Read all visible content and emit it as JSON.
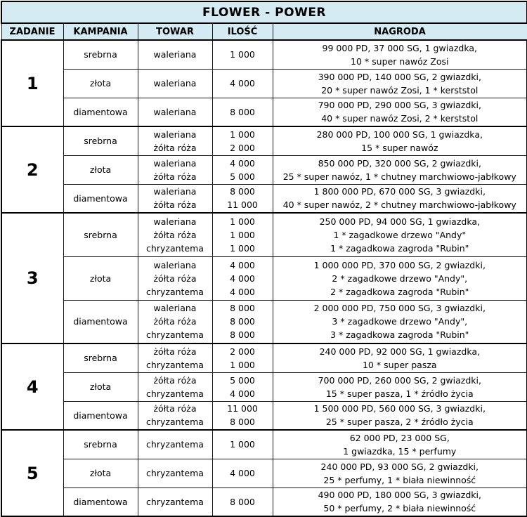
{
  "title": "FLOWER - POWER",
  "headers": [
    "ZADANIE",
    "KAMPANIA",
    "TOWAR",
    "ILOŚĆ",
    "NAGRODA"
  ],
  "tasks": [
    {
      "number": "1",
      "campaigns": [
        {
          "name": "srebrna",
          "items": [
            "waleriana"
          ],
          "qty": [
            "1 000"
          ],
          "reward": [
            "99 000 PD, 37 000 SG, 1 gwiazdka,",
            "10 * super nawóz Zosi"
          ]
        },
        {
          "name": "złota",
          "items": [
            "waleriana"
          ],
          "qty": [
            "4 000"
          ],
          "reward": [
            "390 000 PD, 140 000 SG, 2 gwiazdki,",
            "20 * super nawóz Zosi, 1 * kerststol"
          ]
        },
        {
          "name": "diamentowa",
          "items": [
            "waleriana"
          ],
          "qty": [
            "8 000"
          ],
          "reward": [
            "790 000 PD, 290 000 SG, 3 gwiazdki,",
            "40 * super nawóz Zosi, 2 * kerststol"
          ]
        }
      ]
    },
    {
      "number": "2",
      "campaigns": [
        {
          "name": "srebrna",
          "items": [
            "waleriana",
            "żółta róża"
          ],
          "qty": [
            "1 000",
            "2 000"
          ],
          "reward": [
            "280 000 PD, 100 000 SG, 1 gwiazdka,",
            "15 * super nawóz"
          ]
        },
        {
          "name": "złota",
          "items": [
            "waleriana",
            "żółta róża"
          ],
          "qty": [
            "4 000",
            "5 000"
          ],
          "reward": [
            "850 000 PD, 320 000 SG, 2 gwiazdki,",
            "25 * super nawóz, 1 * chutney marchwiowo-jabłkowy"
          ]
        },
        {
          "name": "diamentowa",
          "items": [
            "waleriana",
            "żółta róża"
          ],
          "qty": [
            "8 000",
            "11 000"
          ],
          "reward": [
            "1 800 000 PD, 670 000 SG, 3 gwiazdki,",
            "40 * super nawóz, 2 * chutney marchwiowo-jabłkowy"
          ]
        }
      ]
    },
    {
      "number": "3",
      "campaigns": [
        {
          "name": "srebrna",
          "items": [
            "waleriana",
            "żółta róża",
            "chryzantema"
          ],
          "qty": [
            "1 000",
            "1 000",
            "1 000"
          ],
          "reward": [
            "250 000 PD, 94 000 SG, 1 gwiazdka,",
            "1 * zagadkowe drzewo \"Andy\"",
            "1 * zagadkowa zagroda \"Rubin\""
          ]
        },
        {
          "name": "złota",
          "items": [
            "waleriana",
            "żółta róża",
            "chryzantema"
          ],
          "qty": [
            "4 000",
            "4 000",
            "4 000"
          ],
          "reward": [
            "1 000 000 PD, 370 000 SG, 2 gwiazdki,",
            "2 * zagadkowe drzewo \"Andy\",",
            "2 * zagadkowa zagroda \"Rubin\""
          ]
        },
        {
          "name": "diamentowa",
          "items": [
            "waleriana",
            "żółta róża",
            "chryzantema"
          ],
          "qty": [
            "8 000",
            "8 000",
            "8 000"
          ],
          "reward": [
            "2 000 000 PD, 750 000 SG, 3 gwiazdki,",
            "3 * zagadkowe drzewo \"Andy\",",
            "3 * zagadkowa zagroda \"Rubin\""
          ]
        }
      ]
    },
    {
      "number": "4",
      "campaigns": [
        {
          "name": "srebrna",
          "items": [
            "żółta róża",
            "chryzantema"
          ],
          "qty": [
            "2 000",
            "1 000"
          ],
          "reward": [
            "240 000 PD, 92 000 SG, 1 gwiazdka,",
            "10 * super pasza"
          ]
        },
        {
          "name": "złota",
          "items": [
            "żółta róża",
            "chryzantema"
          ],
          "qty": [
            "5 000",
            "4 000"
          ],
          "reward": [
            "700 000 PD, 260 000 SG, 2 gwiazdki,",
            "15 * super pasza, 1 * źródło życia"
          ]
        },
        {
          "name": "diamentowa",
          "items": [
            "żółta róża",
            "chryzantema"
          ],
          "qty": [
            "11 000",
            "8 000"
          ],
          "reward": [
            "1 500 000 PD, 560 000 SG, 3 gwiazdki,",
            "25 * super pasza, 2 * źródło życia"
          ]
        }
      ]
    },
    {
      "number": "5",
      "campaigns": [
        {
          "name": "srebrna",
          "items": [
            "chryzantema"
          ],
          "qty": [
            "1 000"
          ],
          "reward": [
            "62 000 PD, 23 000 SG,",
            "1 gwiazdka, 15 * perfumy"
          ]
        },
        {
          "name": "złota",
          "items": [
            "chryzantema"
          ],
          "qty": [
            "4 000"
          ],
          "reward": [
            "240 000 PD, 93 000 SG, 2 gwiazdki,",
            "25 * perfumy, 1 * biała niewinność"
          ]
        },
        {
          "name": "diamentowa",
          "items": [
            "chryzantema"
          ],
          "qty": [
            "8 000"
          ],
          "reward": [
            "490 000 PD, 180 000 SG, 3 gwiazdki,",
            "50 * perfumy, 2 * biała niewinność"
          ]
        }
      ]
    }
  ]
}
